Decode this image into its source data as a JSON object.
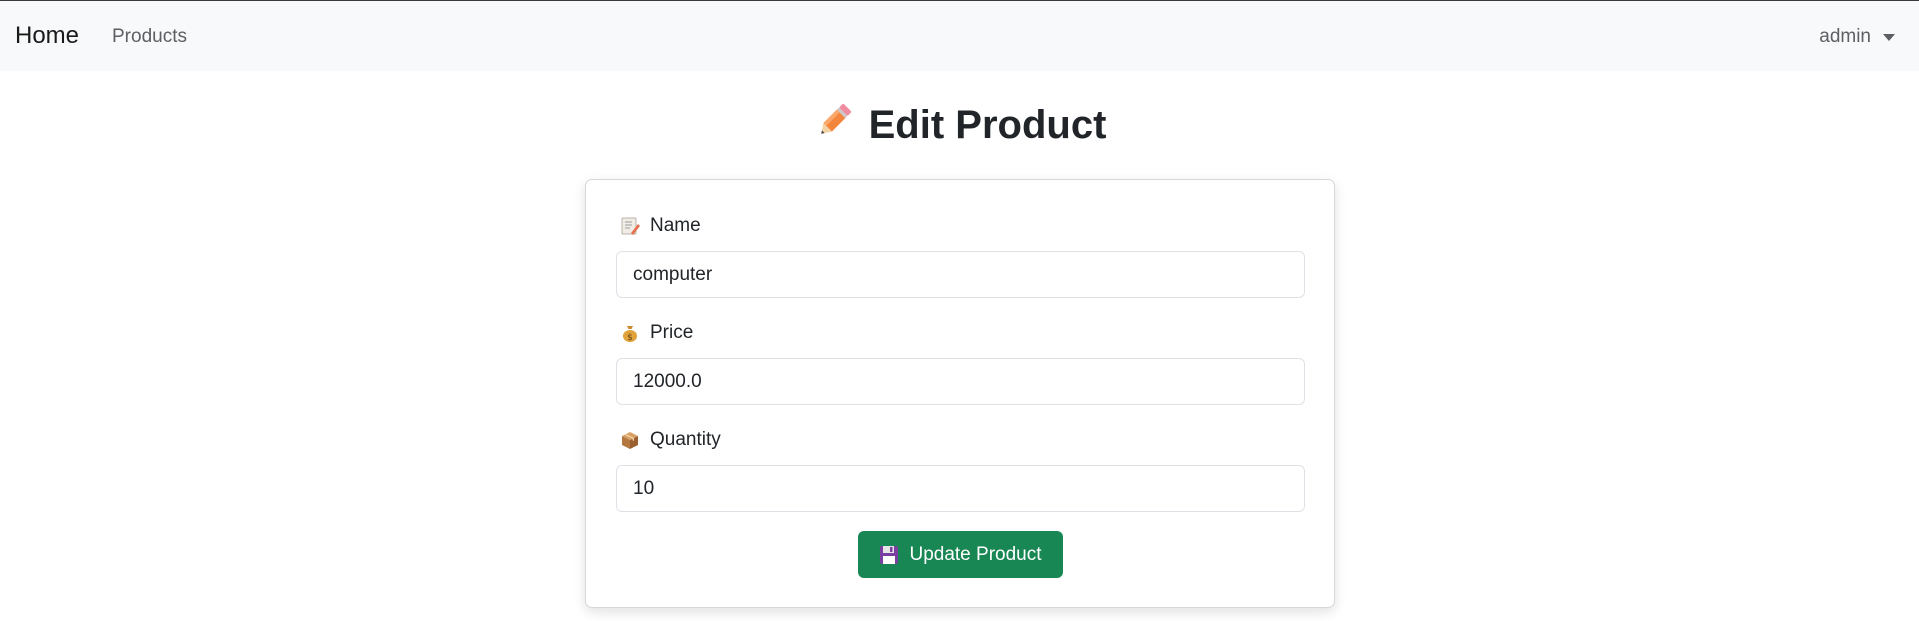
{
  "navbar": {
    "brand": "Home",
    "links": [
      "Products"
    ],
    "user": "admin"
  },
  "page": {
    "title": "Edit Product",
    "title_icon": "pencil-icon"
  },
  "form": {
    "name": {
      "label": "Name",
      "icon": "memo-icon",
      "value": "computer"
    },
    "price": {
      "label": "Price",
      "icon": "money-bag-icon",
      "value": "12000.0"
    },
    "quantity": {
      "label": "Quantity",
      "icon": "package-icon",
      "value": "10"
    },
    "submit": {
      "label": "Update Product",
      "icon": "floppy-disk-icon"
    }
  },
  "colors": {
    "navbar_bg": "#f8f9fa",
    "button_bg": "#198754"
  }
}
